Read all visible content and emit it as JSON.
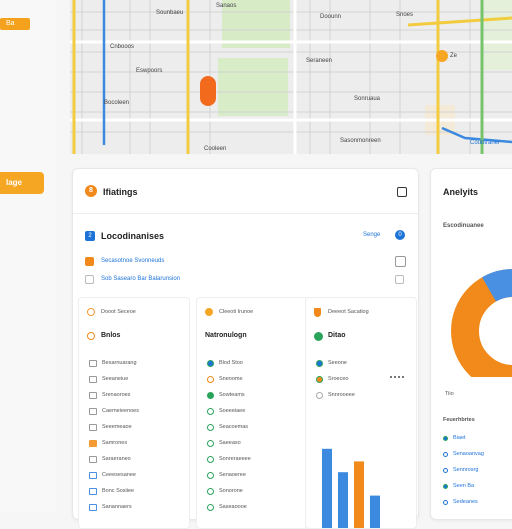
{
  "rail": {
    "top_badge": "Ba",
    "active_item": "Iage"
  },
  "map": {
    "labels": [
      "Sanaos",
      "Sounbaeu",
      "Doounn",
      "Snoes",
      "Cnbooos",
      "Eswpoors",
      "Seraneen",
      "Sonruaua",
      "Sasonmonreen",
      "Cooleen",
      "Bocoleen",
      "Coubtraner"
    ],
    "pin_label": "Ze"
  },
  "main": {
    "badge": "8",
    "title": "Ifiatings",
    "section": {
      "number": "2",
      "title": "Locodinanises",
      "link": "Senge",
      "link_badge": "0"
    },
    "checks": [
      {
        "label": "Secasotnoe Svonneuds",
        "state": "orange"
      },
      {
        "label": "Sob Sasearo Bar Balarunsion",
        "state": "empty"
      }
    ],
    "columns": [
      {
        "header": "Dooot Seceoe",
        "title": "Bnlos",
        "items": [
          "Besarnuarang",
          "Seeaneiue",
          "Srenaoroes",
          "Caemeieenoes",
          "Seeemeaoe",
          "Samrones",
          "Saraeraneo",
          "Ceeesesanee",
          "Bonc Sosiiee",
          "Sanannaers"
        ]
      },
      {
        "header": "Cleeoti Irunoe",
        "title": "Natronulogn",
        "items": [
          "Blod Stoo",
          "Sneoome",
          "Sowteams",
          "Soeeeiaee",
          "Seacoemas",
          "Saeeaso",
          "Sonreraeeee",
          "Senaoeree",
          "Sonorone",
          "Saseaoooe"
        ]
      },
      {
        "header": "Deeeot Sacatiog",
        "title": "Ditao",
        "items": [
          "Seeone",
          "Sroeceo",
          "Snnrooeee"
        ],
        "chart_values": [
          44,
          31,
          37,
          18
        ]
      }
    ]
  },
  "side": {
    "title": "Anelyits",
    "subtitle": "Escodinuanee",
    "pie_label": "Tiio",
    "legend_title": "Feuerhbrtes",
    "legend": [
      "Biaet",
      "Senaoanvag",
      "Sennrosrg",
      "Seen Ba",
      "Sedeanes"
    ]
  },
  "colors": {
    "accent": "#f18a1a",
    "blue": "#1e73d8",
    "green": "#2aa35b"
  }
}
